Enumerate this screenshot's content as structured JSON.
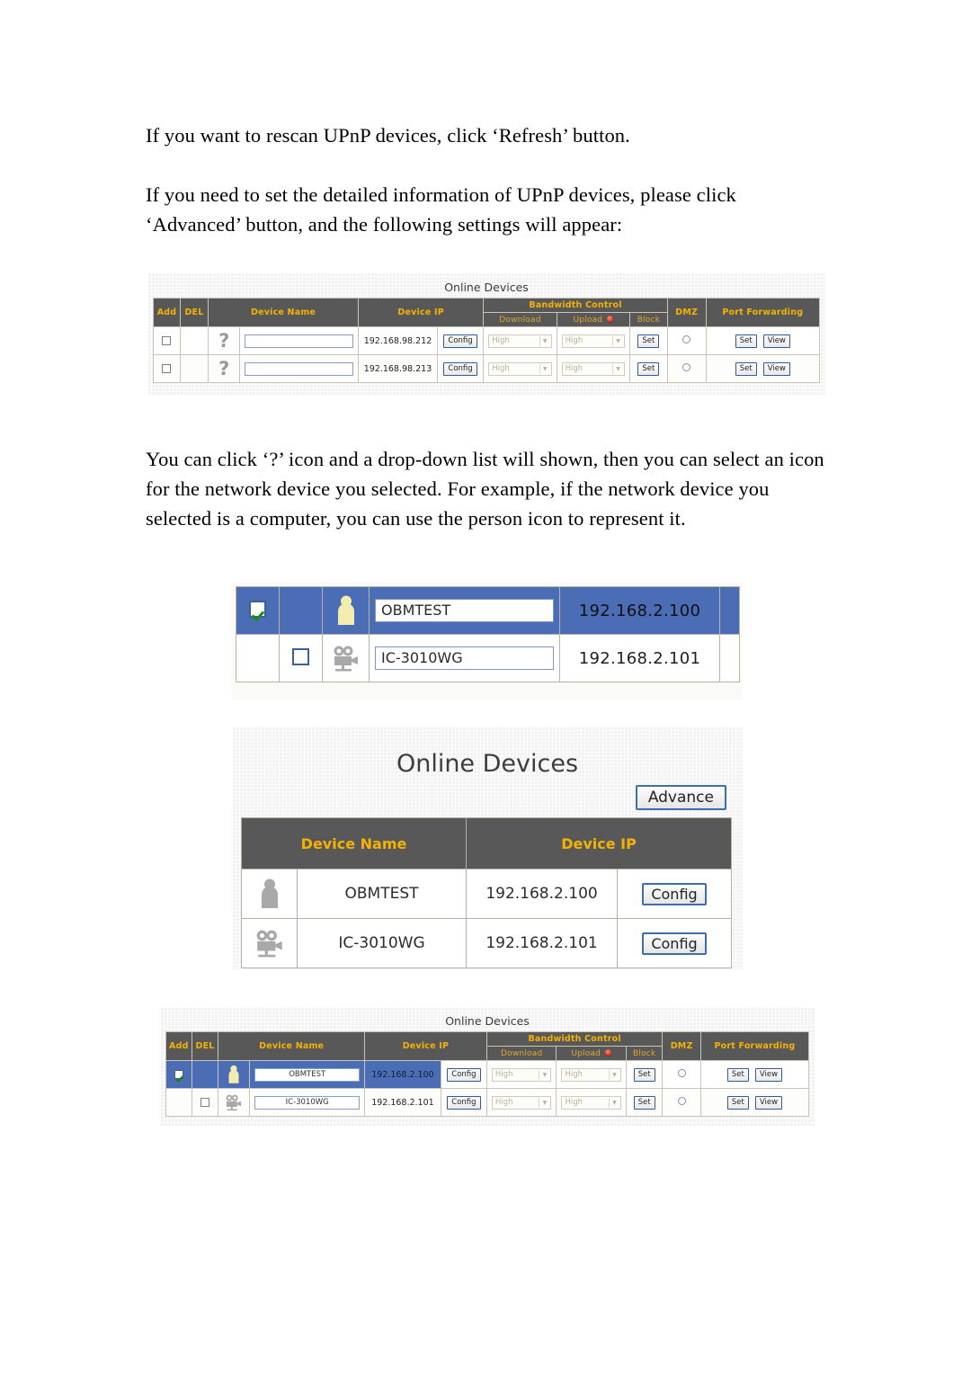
{
  "document": {
    "paragraphs": [
      "If you want to rescan UPnP devices, click ‘Refresh’ button.",
      "If you need to set the detailed information of UPnP devices, please click ‘Advanced’ button, and the following settings will appear:",
      "You can click ‘?’ icon and a drop-down list will shown, then you can select an icon for the network device you selected. For example, if the network device you selected is a computer, you can use the person icon to represent it."
    ]
  },
  "colors": {
    "header_bg": "#585858",
    "header_text": "#f5b200",
    "selected_row": "#4a6db5",
    "button_border": "#3d6ea8",
    "panel_bg": "#f2f2f2"
  },
  "screenshot_advanced_table": {
    "title": "Online Devices",
    "columns": {
      "add": "Add",
      "del": "DEL",
      "device_name": "Device Name",
      "device_ip": "Device IP",
      "bandwidth_control": "Bandwidth Control",
      "download": "Download",
      "upload": "Upload",
      "block": "Block",
      "dmz": "DMZ",
      "port_forwarding": "Port Forwarding"
    },
    "upload_icon": "alert-dot-icon",
    "rows": [
      {
        "add_checked": false,
        "del_checked": false,
        "icon": "question-mark-icon",
        "device_name": "",
        "device_name_placeholder": "",
        "device_ip": "192.168.98.212",
        "config_label": "Config",
        "download": "High",
        "upload": "High",
        "block_label": "Set",
        "dmz_selected": false,
        "pf_set_label": "Set",
        "pf_view_label": "View"
      },
      {
        "add_checked": false,
        "del_checked": false,
        "icon": "question-mark-icon",
        "device_name": "",
        "device_name_placeholder": "",
        "device_ip": "192.168.98.213",
        "config_label": "Config",
        "download": "High",
        "upload": "High",
        "block_label": "Set",
        "dmz_selected": false,
        "pf_set_label": "Set",
        "pf_view_label": "View"
      }
    ]
  },
  "screenshot_icon_picker": {
    "rows": [
      {
        "selected": true,
        "add_checked": true,
        "del_checked": false,
        "icon": "person-icon",
        "device_name": "OBMTEST",
        "device_ip": "192.168.2.100"
      },
      {
        "selected": false,
        "add_checked": false,
        "del_checked": false,
        "icon": "video-camera-icon",
        "device_name": "IC-3010WG",
        "device_ip": "192.168.2.101"
      }
    ]
  },
  "screenshot_online_devices": {
    "title": "Online Devices",
    "advance_label": "Advance",
    "columns": {
      "device_name": "Device Name",
      "device_ip": "Device IP"
    },
    "rows": [
      {
        "icon": "person-icon",
        "device_name": "OBMTEST",
        "device_ip": "192.168.2.100",
        "config_label": "Config"
      },
      {
        "icon": "video-camera-icon",
        "device_name": "IC-3010WG",
        "device_ip": "192.168.2.101",
        "config_label": "Config"
      }
    ]
  },
  "screenshot_advanced_filled": {
    "title": "Online Devices",
    "columns": {
      "add": "Add",
      "del": "DEL",
      "device_name": "Device Name",
      "device_ip": "Device IP",
      "bandwidth_control": "Bandwidth Control",
      "download": "Download",
      "upload": "Upload",
      "block": "Block",
      "dmz": "DMZ",
      "port_forwarding": "Port Forwarding"
    },
    "upload_icon": "alert-dot-icon",
    "rows": [
      {
        "selected": true,
        "add_checked": true,
        "del_checked": false,
        "icon": "person-icon",
        "device_name": "OBMTEST",
        "device_ip": "192.168.2.100",
        "config_label": "Config",
        "download": "High",
        "upload": "High",
        "block_label": "Set",
        "dmz_selected": false,
        "pf_set_label": "Set",
        "pf_view_label": "View"
      },
      {
        "selected": false,
        "add_checked": false,
        "del_checked": false,
        "icon": "video-camera-icon",
        "device_name": "IC-3010WG",
        "device_ip": "192.168.2.101",
        "config_label": "Config",
        "download": "High",
        "upload": "High",
        "block_label": "Set",
        "dmz_selected": false,
        "pf_set_label": "Set",
        "pf_view_label": "View"
      }
    ]
  }
}
